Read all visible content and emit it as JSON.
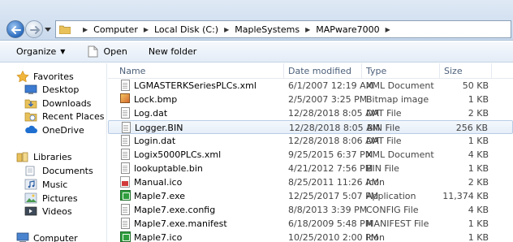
{
  "address": {
    "crumbs": [
      "Computer",
      "Local Disk (C:)",
      "MapleSystems",
      "MAPware7000"
    ]
  },
  "toolbar": {
    "organize_label": "Organize",
    "open_label": "Open",
    "new_folder_label": "New folder"
  },
  "nav": {
    "favorites": "Favorites",
    "desktop": "Desktop",
    "downloads": "Downloads",
    "recent_places": "Recent Places",
    "onedrive": "OneDrive",
    "libraries": "Libraries",
    "documents": "Documents",
    "music": "Music",
    "pictures": "Pictures",
    "videos": "Videos",
    "computer": "Computer"
  },
  "columns": {
    "name": "Name",
    "date_modified": "Date modified",
    "type": "Type",
    "size": "Size"
  },
  "files": [
    {
      "name": "LGMASTERKSeriesPLCs.xml",
      "date": "6/1/2007 12:19 AM",
      "type": "XML Document",
      "size": "50 KB",
      "icon": "document-icon"
    },
    {
      "name": "Lock.bmp",
      "date": "2/5/2007 3:25 PM",
      "type": "Bitmap image",
      "size": "1 KB",
      "icon": "bitmap-icon"
    },
    {
      "name": "Log.dat",
      "date": "12/28/2018 8:05 AM",
      "type": "DAT File",
      "size": "2 KB",
      "icon": "document-icon"
    },
    {
      "name": "Logger.BIN",
      "date": "12/28/2018 8:05 AM",
      "type": "BIN File",
      "size": "256 KB",
      "icon": "document-icon"
    },
    {
      "name": "Login.dat",
      "date": "12/28/2018 8:06 AM",
      "type": "DAT File",
      "size": "1 KB",
      "icon": "document-icon"
    },
    {
      "name": "Logix5000PLCs.xml",
      "date": "9/25/2015 6:37 PM",
      "type": "XML Document",
      "size": "4 KB",
      "icon": "document-icon"
    },
    {
      "name": "lookuptable.bin",
      "date": "4/21/2012 7:56 PM",
      "type": "BIN File",
      "size": "1 KB",
      "icon": "document-icon"
    },
    {
      "name": "Manual.ico",
      "date": "8/25/2011 11:26 AM",
      "type": "Icon",
      "size": "2 KB",
      "icon": "ico-icon"
    },
    {
      "name": "Maple7.exe",
      "date": "12/25/2017 5:07 PM",
      "type": "Application",
      "size": "11,374 KB",
      "icon": "application-icon"
    },
    {
      "name": "Maple7.exe.config",
      "date": "8/8/2013 3:39 PM",
      "type": "CONFIG File",
      "size": "4 KB",
      "icon": "document-icon"
    },
    {
      "name": "Maple7.exe.manifest",
      "date": "6/18/2009 5:48 PM",
      "type": "MANIFEST File",
      "size": "1 KB",
      "icon": "document-icon"
    },
    {
      "name": "Maple7.ico",
      "date": "10/25/2010 2:00 PM",
      "type": "Icon",
      "size": "1 KB",
      "icon": "application-icon"
    }
  ],
  "selected_file": "Logger.BIN",
  "colors": {
    "selection_border": "#b8cde6",
    "header_text": "#4c607a",
    "toolbar_bg": "#e3ecf7"
  }
}
